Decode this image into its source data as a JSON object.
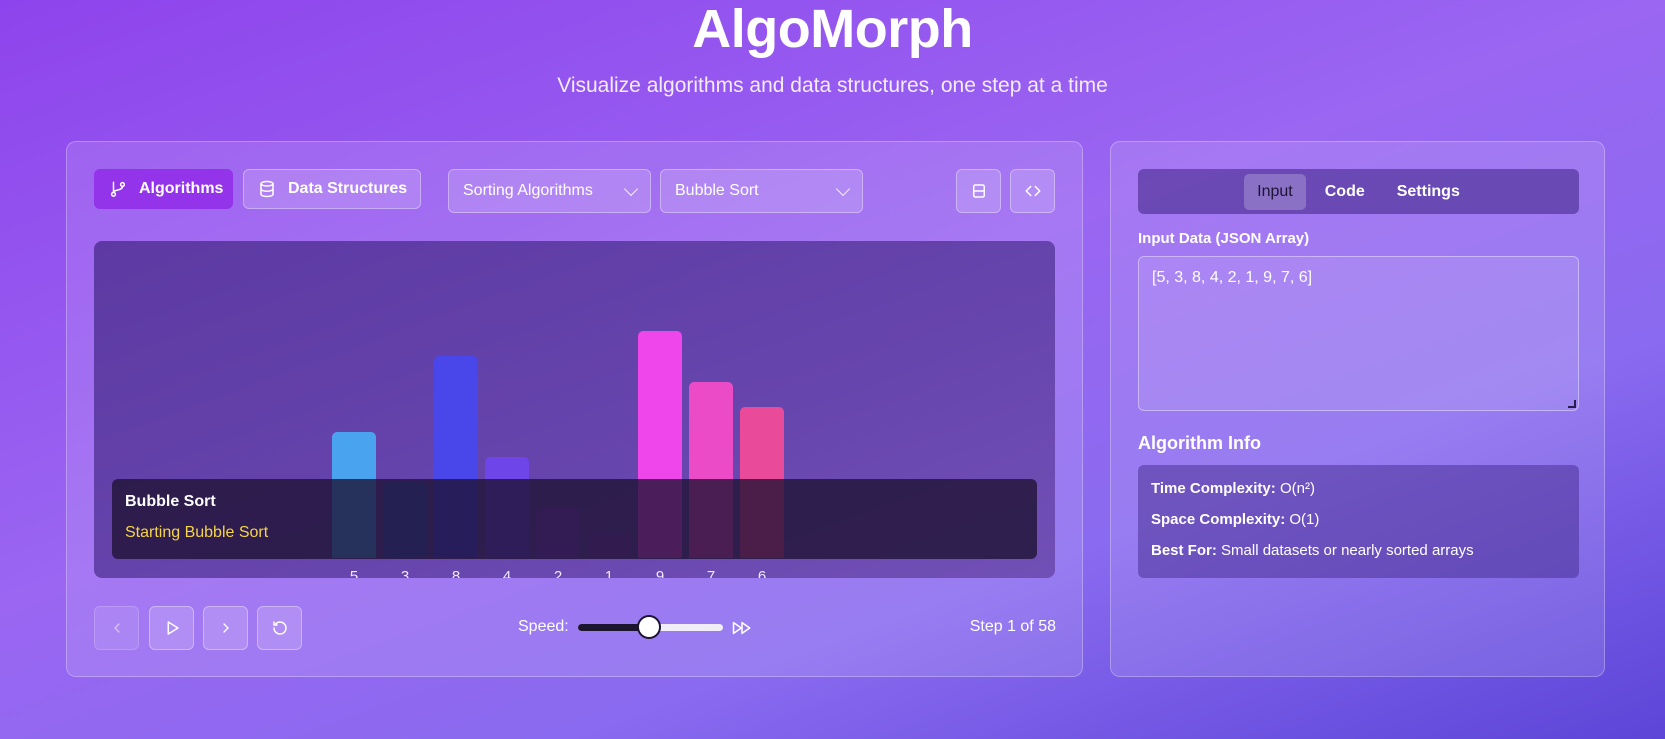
{
  "header": {
    "title": "AlgoMorph",
    "subtitle": "Visualize algorithms and data structures, one step at a time"
  },
  "toolbar": {
    "mode_buttons": [
      {
        "label": "Algorithms",
        "icon": "git-branch-icon",
        "active": true
      },
      {
        "label": "Data Structures",
        "icon": "database-icon",
        "active": false
      }
    ],
    "category_select": "Sorting Algorithms",
    "algorithm_select": "Bubble Sort",
    "layout_icon": "split-view-icon",
    "code_icon": "code-brackets-icon"
  },
  "visualizer": {
    "bars": [
      {
        "value": 5,
        "color": "#4aa3ef"
      },
      {
        "value": 3,
        "color": "#3d53c4"
      },
      {
        "value": 8,
        "color": "#4a47ea"
      },
      {
        "value": 4,
        "color": "#6d45e8"
      },
      {
        "value": 2,
        "color": "#7b3fc7"
      },
      {
        "value": 1,
        "color": "#7c3db0"
      },
      {
        "value": 9,
        "color": "#ee46ea"
      },
      {
        "value": 7,
        "color": "#ec4bc8"
      },
      {
        "value": 6,
        "color": "#ea4a9a"
      }
    ],
    "status_title": "Bubble Sort",
    "status_message": "Starting Bubble Sort"
  },
  "controls": {
    "speed_label": "Speed:",
    "speed_level": 0.49,
    "step_text": "Step 1 of 58"
  },
  "side": {
    "tabs": [
      {
        "label": "Input",
        "active": true
      },
      {
        "label": "Code",
        "active": false
      },
      {
        "label": "Settings",
        "active": false
      }
    ],
    "input_label": "Input Data (JSON Array)",
    "input_value": "[5, 3, 8, 4, 2, 1, 9, 7, 6]",
    "info_heading": "Algorithm Info",
    "info": [
      {
        "key": "Time Complexity:",
        "value": "O(n²)"
      },
      {
        "key": "Space Complexity:",
        "value": "O(1)"
      },
      {
        "key": "Best For:",
        "value": "Small datasets or nearly sorted arrays"
      }
    ]
  }
}
